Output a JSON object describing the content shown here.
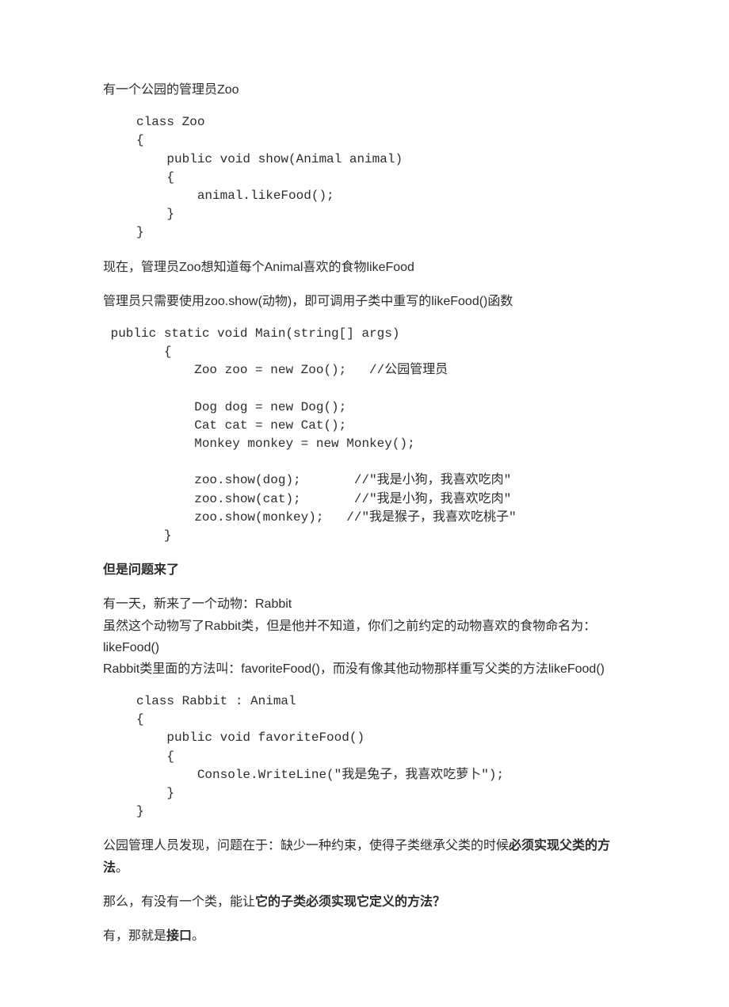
{
  "p1": "有一个公园的管理员Zoo",
  "code_zoo": "class Zoo\n{\n    public void show(Animal animal)\n    {\n        animal.likeFood();\n    }\n}",
  "p2": "现在，管理员Zoo想知道每个Animal喜欢的食物likeFood",
  "p3": "管理员只需要使用zoo.show(动物)，即可调用子类中重写的likeFood()函数",
  "code_main": " public static void Main(string[] args)\n        {\n            Zoo zoo = new Zoo();   //公园管理员\n\n            Dog dog = new Dog();\n            Cat cat = new Cat();\n            Monkey monkey = new Monkey();\n\n            zoo.show(dog);       //\"我是小狗，我喜欢吃肉\"\n            zoo.show(cat);       //\"我是小狗，我喜欢吃肉\"\n            zoo.show(monkey);   //\"我是猴子，我喜欢吃桃子\"\n        }",
  "h1": "但是问题来了",
  "p4": "有一天，新来了一个动物：Rabbit\n虽然这个动物写了Rabbit类，但是他并不知道，你们之前约定的动物喜欢的食物命名为：likeFood()\nRabbit类里面的方法叫：favoriteFood()，而没有像其他动物那样重写父类的方法likeFood()",
  "code_rabbit": "class Rabbit : Animal\n{\n    public void favoriteFood()\n    {\n        Console.WriteLine(\"我是兔子，我喜欢吃萝卜\");\n    }\n}",
  "p5_a": "公园管理人员发现，问题在于：缺少一种约束，使得子类继承父类的时候",
  "p5_b": "必须实现父类的方法",
  "p5_c": "。",
  "p6_a": "那么，有没有一个类，能让",
  "p6_b": "它的子类必须实现它定义的方法？",
  "p7_a": "有，那就是",
  "p7_b": "接口",
  "p7_c": "。"
}
